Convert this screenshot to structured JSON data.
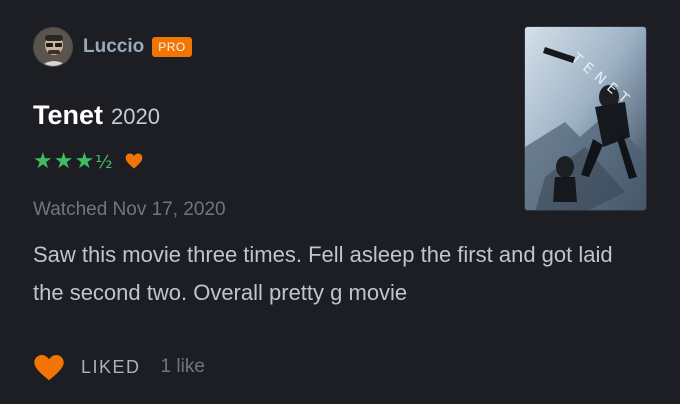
{
  "author": {
    "name": "Luccio",
    "badge": "PRO"
  },
  "film": {
    "title": "Tenet",
    "year": "2020",
    "rating_stars": "★★★",
    "rating_half": "½",
    "rating_value": 3.5,
    "liked": true
  },
  "watched": "Watched Nov 17, 2020",
  "review": "Saw this movie three times. Fell asleep the first and got laid the second two. Overall pretty g movie",
  "footer": {
    "liked_label": "LIKED",
    "likes_count": "1 like"
  },
  "poster": {
    "title_text": "TENET"
  },
  "colors": {
    "background": "#1c1e23",
    "star_green": "#40bc65",
    "heart_orange": "#f27405",
    "badge_orange": "#f27405"
  }
}
